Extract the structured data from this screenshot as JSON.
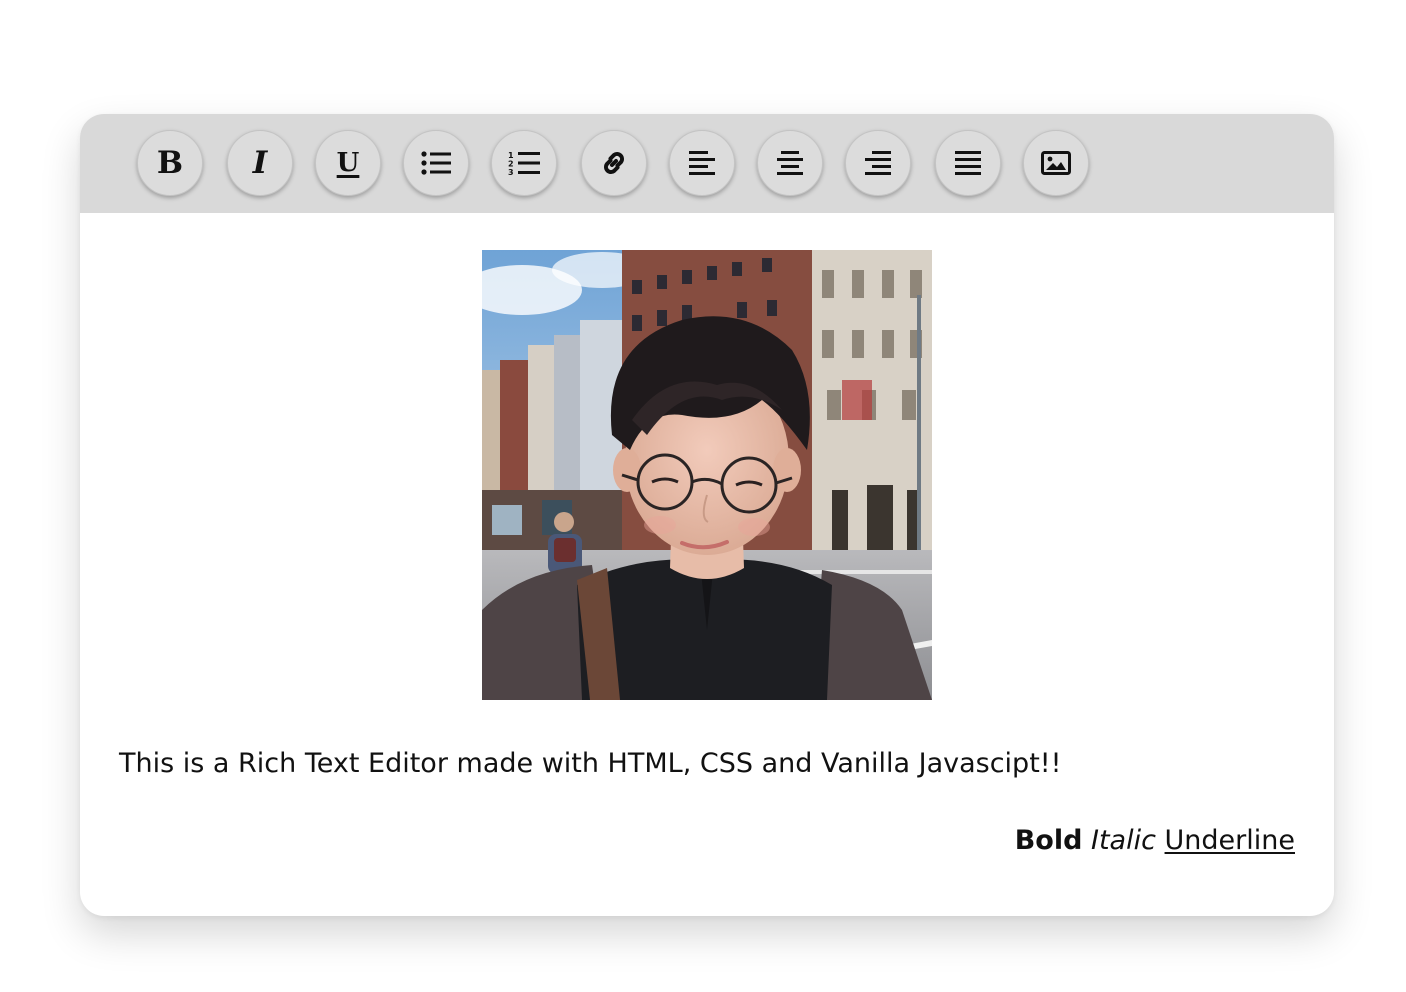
{
  "toolbar": {
    "background": "#d9d9d9",
    "buttons": [
      {
        "name": "bold",
        "label": "B",
        "icon": "bold-icon"
      },
      {
        "name": "italic",
        "label": "I",
        "icon": "italic-icon"
      },
      {
        "name": "underline",
        "label": "U",
        "icon": "underline-icon"
      },
      {
        "name": "unordered-list",
        "icon": "bulleted-list-icon"
      },
      {
        "name": "ordered-list",
        "icon": "numbered-list-icon"
      },
      {
        "name": "link",
        "icon": "link-icon"
      },
      {
        "name": "align-left",
        "icon": "align-left-icon"
      },
      {
        "name": "align-center",
        "icon": "align-center-icon"
      },
      {
        "name": "align-right",
        "icon": "align-right-icon"
      },
      {
        "name": "align-justify",
        "icon": "align-justify-icon"
      },
      {
        "name": "insert-image",
        "icon": "image-icon"
      }
    ]
  },
  "content": {
    "photo_icon": "portrait-photo",
    "paragraph": "This is a Rich Text Editor made with HTML, CSS and Vanilla Javascipt!!",
    "styled_line": {
      "bold": "Bold",
      "italic": "Italic",
      "underline": "Underline"
    }
  }
}
